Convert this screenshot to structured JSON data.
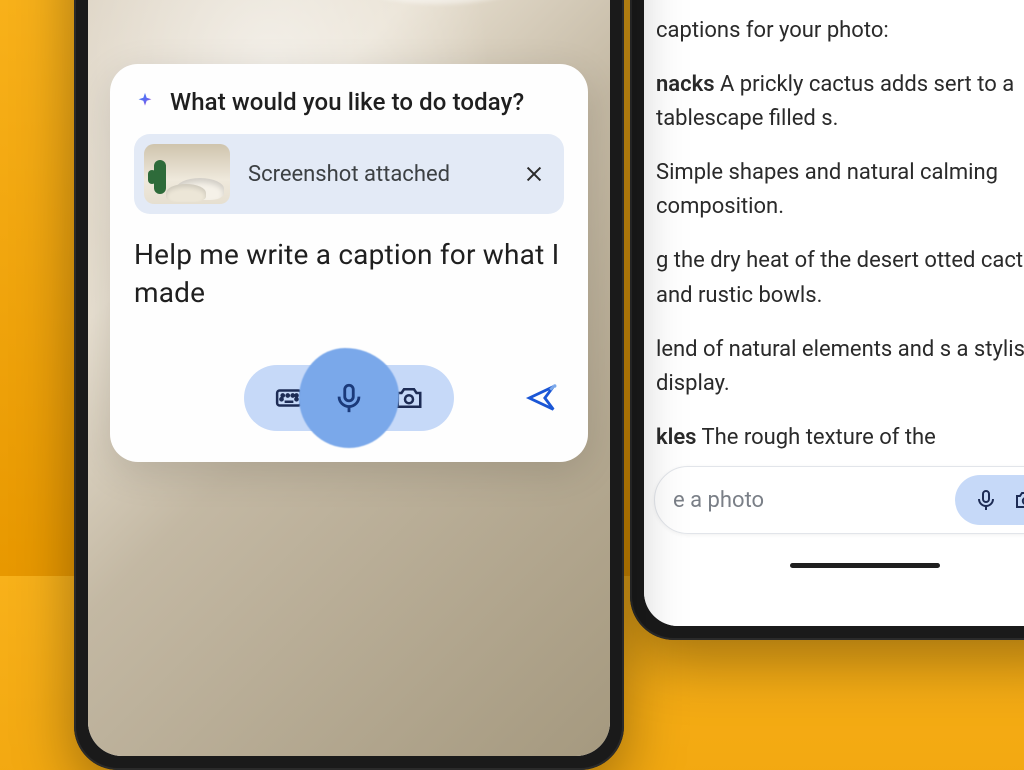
{
  "left": {
    "prompt_title": "What would you like to do today?",
    "attachment_label": "Screenshot attached",
    "typed_text": "Help me write a caption for what I made"
  },
  "right": {
    "heading_fragment": "captions for your photo:",
    "suggestions": [
      {
        "title_fragment": "nacks",
        "body_fragment": " A prickly cactus adds sert to a tablescape filled s."
      },
      {
        "body_fragment": "Simple shapes and natural calming composition."
      },
      {
        "body_fragment": "g the dry heat of the desert otted cactus and rustic bowls."
      },
      {
        "body_fragment": "lend of natural elements and s a stylish display."
      },
      {
        "title_fragment": "kles",
        "body_fragment": " The rough texture of the"
      }
    ],
    "input_placeholder_fragment": "e a photo"
  }
}
